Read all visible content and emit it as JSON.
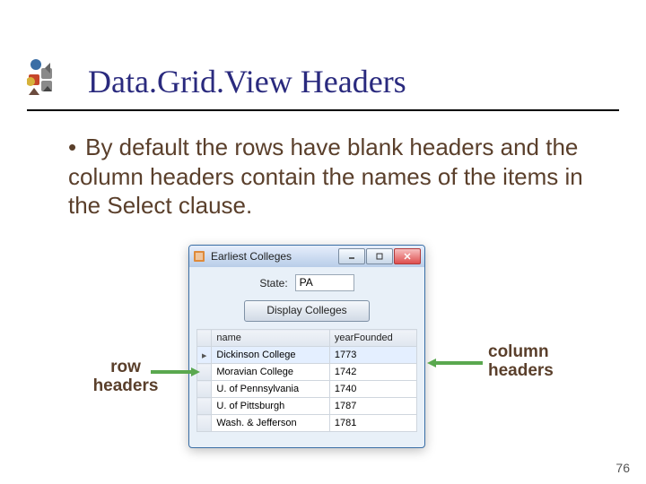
{
  "title": "Data.Grid.View Headers",
  "bullet": "By default the rows have blank headers and the column headers contain the names of the items in the Select clause.",
  "window": {
    "title": "Earliest Colleges",
    "state_label": "State:",
    "state_value": "PA",
    "display_button": "Display Colleges",
    "columns": [
      "name",
      "yearFounded"
    ],
    "rows": [
      {
        "name": "Dickinson College",
        "year": "1773"
      },
      {
        "name": "Moravian College",
        "year": "1742"
      },
      {
        "name": "U. of Pennsylvania",
        "year": "1740"
      },
      {
        "name": "U. of Pittsburgh",
        "year": "1787"
      },
      {
        "name": "Wash. & Jefferson",
        "year": "1781"
      }
    ]
  },
  "annotations": {
    "row_headers_l1": "row",
    "row_headers_l2": "headers",
    "col_headers_l1": "column",
    "col_headers_l2": "headers"
  },
  "page_number": "76"
}
